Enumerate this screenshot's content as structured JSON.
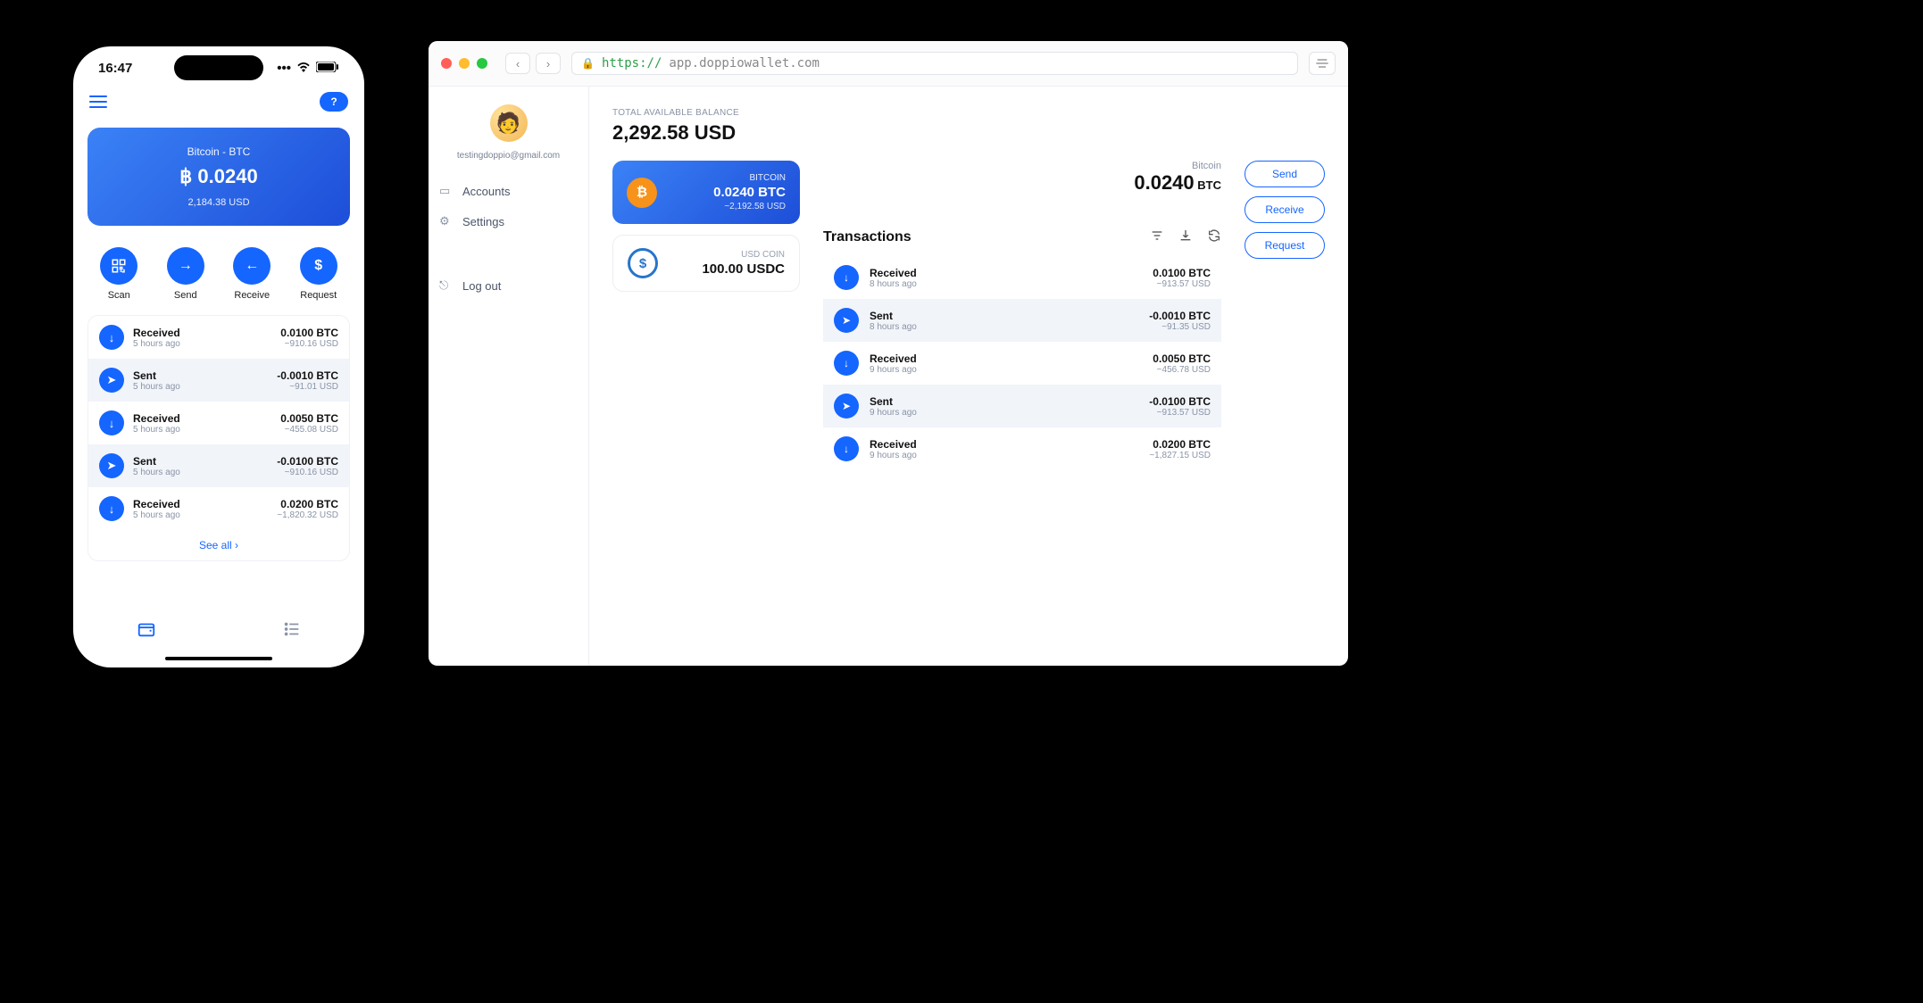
{
  "phone": {
    "status_time": "16:47",
    "balance_card": {
      "title": "Bitcoin - BTC",
      "amount": "฿ 0.0240",
      "fiat": "2,184.38 USD"
    },
    "actions": {
      "scan": "Scan",
      "send": "Send",
      "receive": "Receive",
      "request": "Request"
    },
    "txs": [
      {
        "type": "Received",
        "ago": "5 hours ago",
        "amount": "0.0100 BTC",
        "fiat": "~910.16 USD"
      },
      {
        "type": "Sent",
        "ago": "5 hours ago",
        "amount": "-0.0010 BTC",
        "fiat": "~91.01 USD"
      },
      {
        "type": "Received",
        "ago": "5 hours ago",
        "amount": "0.0050 BTC",
        "fiat": "~455.08 USD"
      },
      {
        "type": "Sent",
        "ago": "5 hours ago",
        "amount": "-0.0100 BTC",
        "fiat": "~910.16 USD"
      },
      {
        "type": "Received",
        "ago": "5 hours ago",
        "amount": "0.0200 BTC",
        "fiat": "~1,820.32 USD"
      }
    ],
    "see_all": "See all"
  },
  "browser": {
    "url_proto": "https://",
    "url_host": "app.doppiowallet.com",
    "sidebar": {
      "email": "testingdoppio@gmail.com",
      "accounts": "Accounts",
      "settings": "Settings",
      "logout": "Log out"
    },
    "balance_label": "TOTAL AVAILABLE BALANCE",
    "balance_value": "2,292.58 USD",
    "wallets": [
      {
        "name": "BITCOIN",
        "amount": "0.0240 BTC",
        "fiat": "~2,192.58 USD"
      },
      {
        "name": "USD COIN",
        "amount": "100.00 USDC",
        "fiat": ""
      }
    ],
    "coin_summary": {
      "name": "Bitcoin",
      "value": "0.0240",
      "unit": " BTC"
    },
    "tx_title": "Transactions",
    "txs": [
      {
        "type": "Received",
        "ago": "8 hours ago",
        "amount": "0.0100 BTC",
        "fiat": "~913.57 USD"
      },
      {
        "type": "Sent",
        "ago": "8 hours ago",
        "amount": "-0.0010 BTC",
        "fiat": "~91.35 USD"
      },
      {
        "type": "Received",
        "ago": "9 hours ago",
        "amount": "0.0050 BTC",
        "fiat": "~456.78 USD"
      },
      {
        "type": "Sent",
        "ago": "9 hours ago",
        "amount": "-0.0100 BTC",
        "fiat": "~913.57 USD"
      },
      {
        "type": "Received",
        "ago": "9 hours ago",
        "amount": "0.0200 BTC",
        "fiat": "~1,827.15 USD"
      }
    ],
    "actions": {
      "send": "Send",
      "receive": "Receive",
      "request": "Request"
    }
  }
}
